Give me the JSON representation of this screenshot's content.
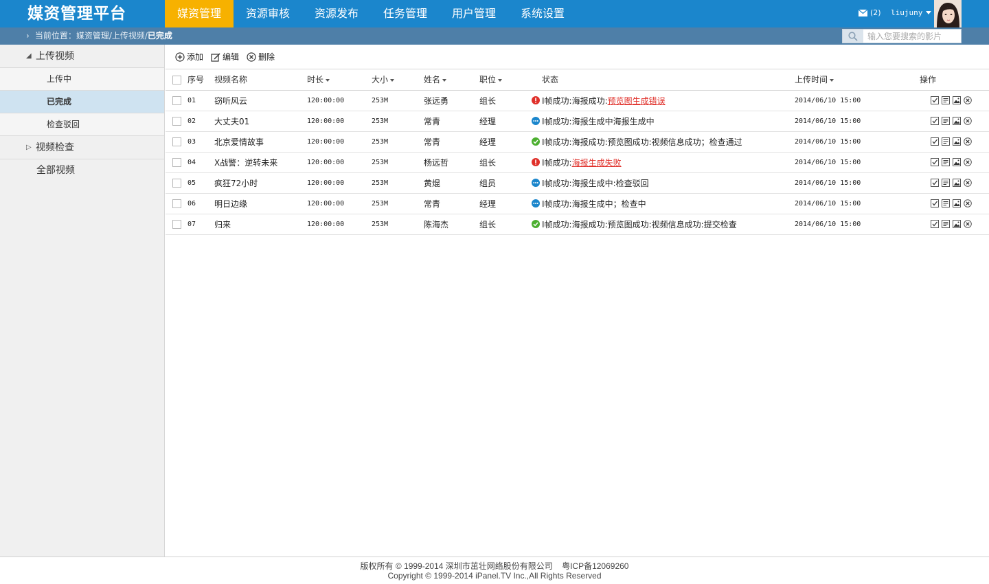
{
  "app": {
    "title": "媒资管理平台"
  },
  "nav": [
    "媒资管理",
    "资源审核",
    "资源发布",
    "任务管理",
    "用户管理",
    "系统设置"
  ],
  "header": {
    "mail_count": "(2)",
    "username": "liujuny"
  },
  "breadcrumb": {
    "prefix": "当前位置：媒资管理/上传视频/",
    "current": "已完成"
  },
  "search": {
    "placeholder": "输入您要搜索的影片"
  },
  "sidebar": {
    "group1": "上传视频",
    "subs": [
      "上传中",
      "已完成",
      "检查驳回"
    ],
    "group2": "视频检查",
    "plain": "全部视频"
  },
  "toolbar": {
    "add": "添加",
    "edit": "编辑",
    "delete": "删除"
  },
  "table": {
    "headers": [
      "序号",
      "视频名称",
      "时长",
      "大小",
      "姓名",
      "职位",
      "状态",
      "上传时间",
      "操作"
    ],
    "rows": [
      {
        "no": "01",
        "name": "窃听风云",
        "duration": "120:00:00",
        "size": "253M",
        "person": "张远勇",
        "title": "组长",
        "status_type": "error",
        "status_text": "I帧成功:海报成功:",
        "status_link": "预览图生成错误",
        "time": "2014/06/10 15:00"
      },
      {
        "no": "02",
        "name": "大丈夫01",
        "duration": "120:00:00",
        "size": "253M",
        "person": "常青",
        "title": "经理",
        "status_type": "progress",
        "status_text": "I帧成功:海报生成中海报生成中",
        "status_link": "",
        "time": "2014/06/10 15:00"
      },
      {
        "no": "03",
        "name": "北京爱情故事",
        "duration": "120:00:00",
        "size": "253M",
        "person": "常青",
        "title": "经理",
        "status_type": "ok",
        "status_text": "I帧成功:海报成功:预览图成功:视频信息成功；检查通过",
        "status_link": "",
        "time": "2014/06/10 15:00"
      },
      {
        "no": "04",
        "name": "X战警：逆转未来",
        "duration": "120:00:00",
        "size": "253M",
        "person": "杨远哲",
        "title": "组长",
        "status_type": "error",
        "status_text": "I帧成功:",
        "status_link": "海报生成失败",
        "time": "2014/06/10 15:00"
      },
      {
        "no": "05",
        "name": "疯狂72小时",
        "duration": "120:00:00",
        "size": "253M",
        "person": "黄焜",
        "title": "组员",
        "status_type": "progress",
        "status_text": "I帧成功:海报生成中:检查驳回",
        "status_link": "",
        "time": "2014/06/10 15:00"
      },
      {
        "no": "06",
        "name": "明日边缘",
        "duration": "120:00:00",
        "size": "253M",
        "person": "常青",
        "title": "经理",
        "status_type": "progress",
        "status_text": "I帧成功:海报生成中；检查中",
        "status_link": "",
        "time": "2014/06/10 15:00"
      },
      {
        "no": "07",
        "name": "归来",
        "duration": "120:00:00",
        "size": "253M",
        "person": "陈海杰",
        "title": "组长",
        "status_type": "ok",
        "status_text": "I帧成功:海报成功:预览图成功:视频信息成功:提交检查",
        "status_link": "",
        "time": "2014/06/10 15:00"
      }
    ]
  },
  "colors": {
    "topbar": "#1b86cc",
    "nav_active": "#f7b100",
    "crumbbar": "#4e7fa8",
    "error": "#e0302a",
    "progress": "#1b86cc",
    "ok": "#4caf30"
  },
  "footer": {
    "line1": "版权所有 © 1999-2014 深圳市茁壮网络股份有限公司    粤ICP备12069260",
    "line2": "Copyright © 1999-2014 iPanel.TV Inc.,All Rights Reserved"
  }
}
